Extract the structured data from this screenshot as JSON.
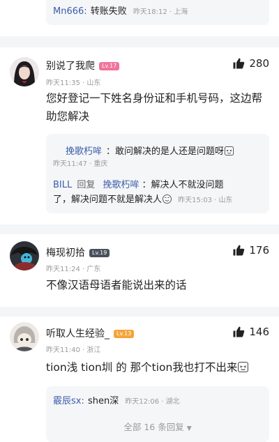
{
  "top_reply": {
    "name": "Mn666:",
    "text": "转账失败",
    "meta": "昨天18:12 · 上海"
  },
  "comments": [
    {
      "username": "别说了我爬",
      "level": "Lv.17",
      "meta": "昨天11:35 · 山东",
      "likes": "280",
      "text": "您好登记一下姓名身份证和手机号码，这边帮助您解决",
      "replies": [
        {
          "name": "挽歌朽哞",
          "sep": "：",
          "text": "敢问解决的是人还是问题呀",
          "meta": "昨天11:47 · 重庆"
        },
        {
          "name": "BILL",
          "reply_word": "回复",
          "to": "挽歌朽哞",
          "sep": "：",
          "text_line1": "解决人不就没问题",
          "text_line2": "了，解决问题不就是解决人",
          "meta": "昨天15:03 · 山东"
        }
      ]
    },
    {
      "username": "梅现初拾",
      "level": "Lv.19",
      "meta": "昨天11:24 · 广东",
      "likes": "176",
      "text": "不像汉语母语者能说出来的话"
    },
    {
      "username": "听取人生经验_",
      "level": "Lv.13",
      "meta": "昨天11:40 · 浙江",
      "likes": "146",
      "text": "tion浅 tion圳 的 那个tion我也打不出来",
      "replies": [
        {
          "name": "霰辰sx:",
          "text": "shen深",
          "meta": "昨天12:06 · 湖北"
        }
      ],
      "more_replies": "全部 16 条回复"
    }
  ],
  "colors": {
    "link": "#3b5cab",
    "badge_pink": "#f2739a",
    "badge_dark": "#4a4f5c",
    "badge_orange": "#f5a33b"
  }
}
